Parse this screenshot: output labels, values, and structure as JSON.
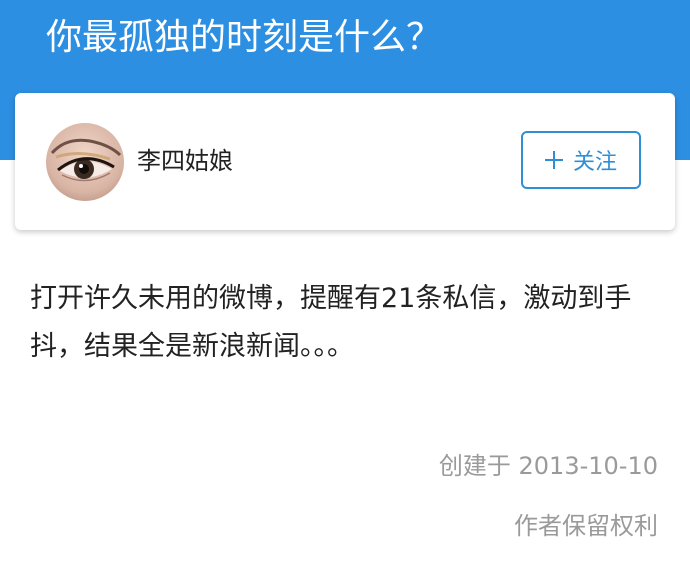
{
  "question": {
    "title": "你最孤独的时刻是什么？"
  },
  "author": {
    "name": "李四姑娘",
    "follow_label": "关注"
  },
  "answer": {
    "text": "打开许久未用的微博，提醒有21条私信，激动到手抖，结果全是新浪新闻。。。"
  },
  "footer": {
    "created": "创建于 2013-10-10",
    "copyright": "作者保留权利"
  },
  "colors": {
    "header_bg": "#2d8fe2",
    "accent": "#2f8fd6",
    "muted_text": "#9a9a9a"
  },
  "icons": {
    "avatar": "avatar-eye-photo",
    "follow": "plus-icon"
  }
}
